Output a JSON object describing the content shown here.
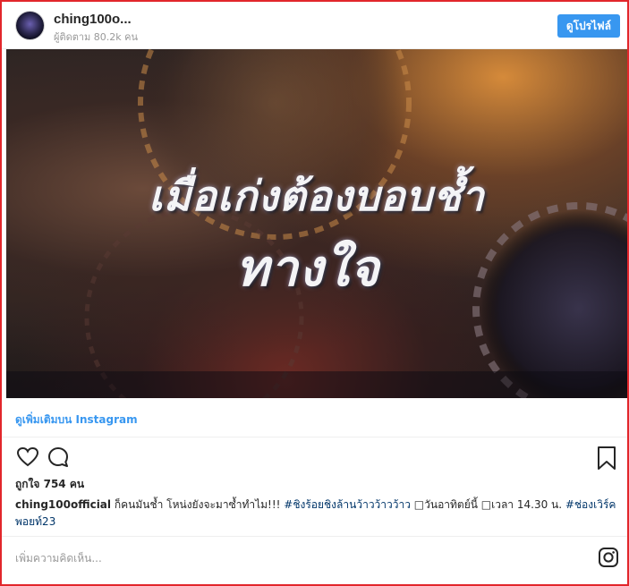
{
  "header": {
    "username": "ching100o...",
    "followers": "ผู้ติดตาม 80.2k คน",
    "profile_button": "ดูโปรไฟล์"
  },
  "media": {
    "headline_line1": "เมื่อเก่งต้องบอบช้ำ",
    "headline_line2": "ทางใจ"
  },
  "view_more": "ดูเพิ่มเติมบน Instagram",
  "actions": {
    "icons": [
      "heart-icon",
      "comment-icon",
      "bookmark-icon"
    ]
  },
  "likes": "ถูกใจ 754 คน",
  "caption": {
    "username": "ching100official",
    "text1": " ก็คนมันช้ำ โหน่งยังจะมาซ้ำทำไม!!! ",
    "hashtag1": "#ชิงร้อยชิงล้านว้าวว้าวว้าว",
    "text2": " □วันอาทิตย์นี้ □เวลา 14.30 น. ",
    "hashtag2": "#ช่องเวิร์คพอยท์23"
  },
  "comment_placeholder": "เพิ่มความคิดเห็น...",
  "colors": {
    "accent": "#3897f0",
    "frame_border": "#e2262b",
    "hashtag": "#003569"
  }
}
